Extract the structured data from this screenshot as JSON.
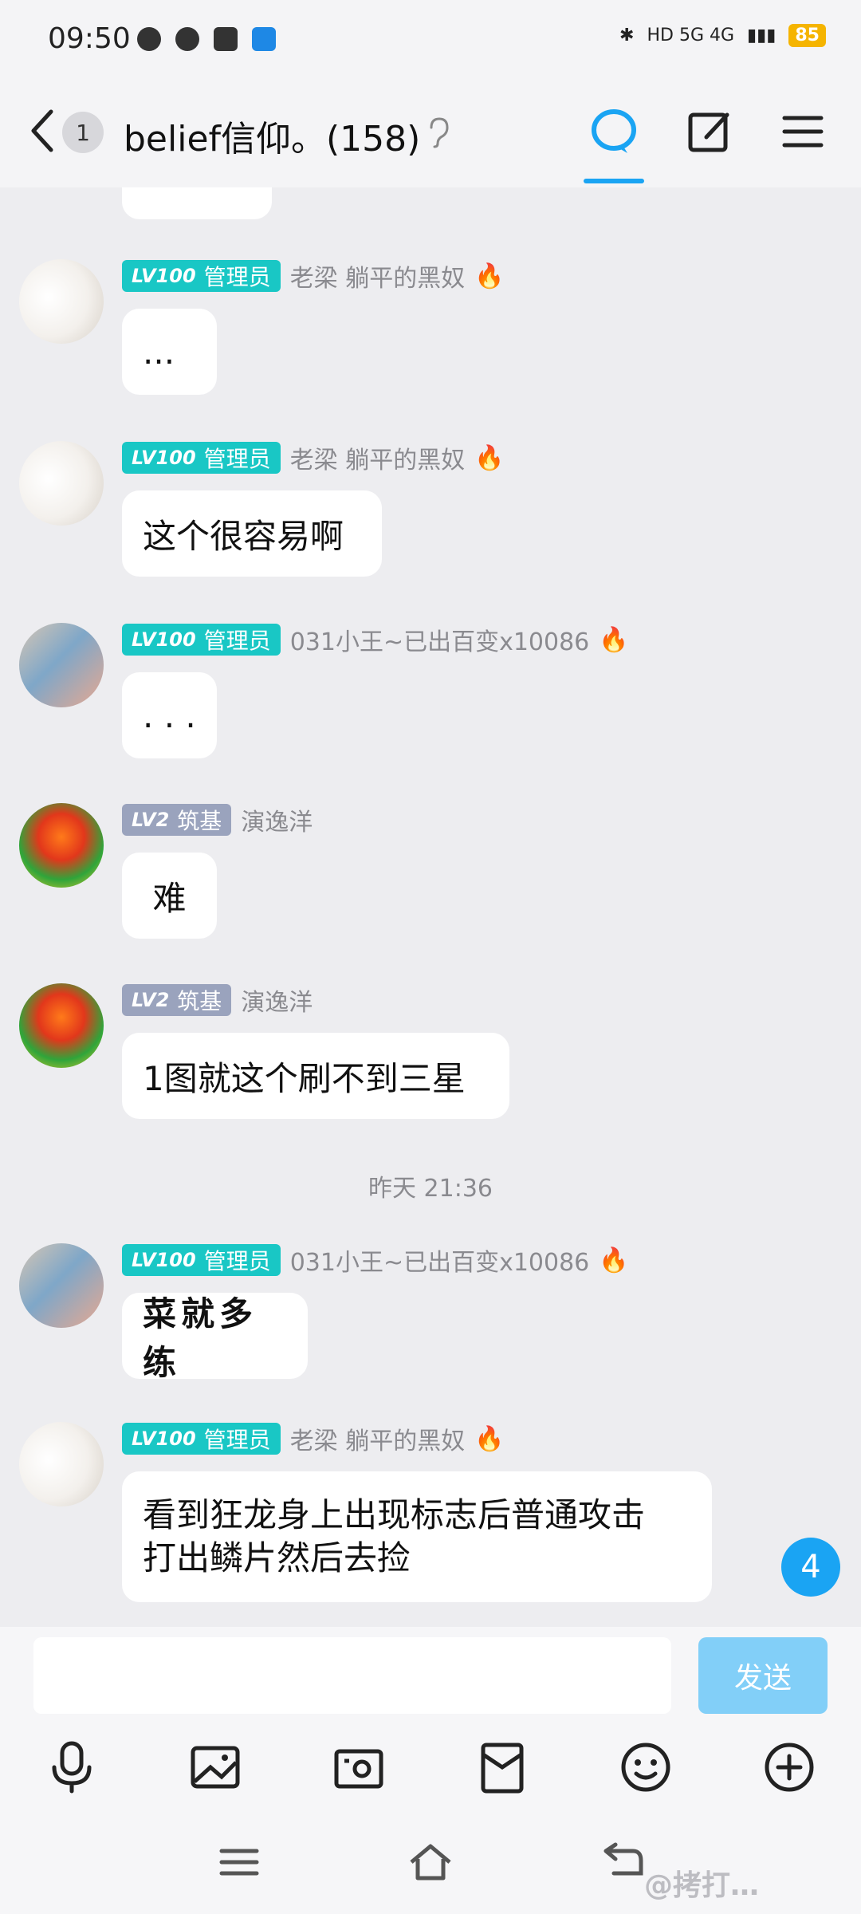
{
  "status_bar": {
    "time": "09:50",
    "right_label": "HD 5G 4G",
    "battery": "85"
  },
  "header": {
    "unread_count": "1",
    "title": "belief信仰。(158)"
  },
  "messages": [
    {
      "level": "LV100",
      "role": "管理员",
      "nickname": "老梁  躺平的黑奴",
      "text": "..."
    },
    {
      "level": "LV100",
      "role": "管理员",
      "nickname": "老梁  躺平的黑奴",
      "text": "这个很容易啊"
    },
    {
      "level": "LV100",
      "role": "管理员",
      "nickname": "031小王~已出百变x10086",
      "text": ". . ."
    },
    {
      "level": "LV2",
      "role": "筑基",
      "nickname": "演逸洋",
      "text": "难"
    },
    {
      "level": "LV2",
      "role": "筑基",
      "nickname": "演逸洋",
      "text": "1图就这个刷不到三星"
    },
    {
      "level": "LV100",
      "role": "管理员",
      "nickname": "031小王~已出百变x10086",
      "text": "菜就多练"
    },
    {
      "level": "LV100",
      "role": "管理员",
      "nickname": "老梁  躺平的黑奴",
      "text_line1": "看到狂龙身上出现标志后普通攻击",
      "text_line2": "打出鳞片然后去捡"
    }
  ],
  "timestamp": "昨天 21:36",
  "unread_bubble": "4",
  "input": {
    "placeholder": "",
    "send_label": "发送"
  },
  "watermark": "@拷打…",
  "colors": {
    "accent": "#1aa4f3",
    "admin_badge": "#19c7c5",
    "basic_badge": "#9aa3bd",
    "send_button": "#82cff8"
  }
}
